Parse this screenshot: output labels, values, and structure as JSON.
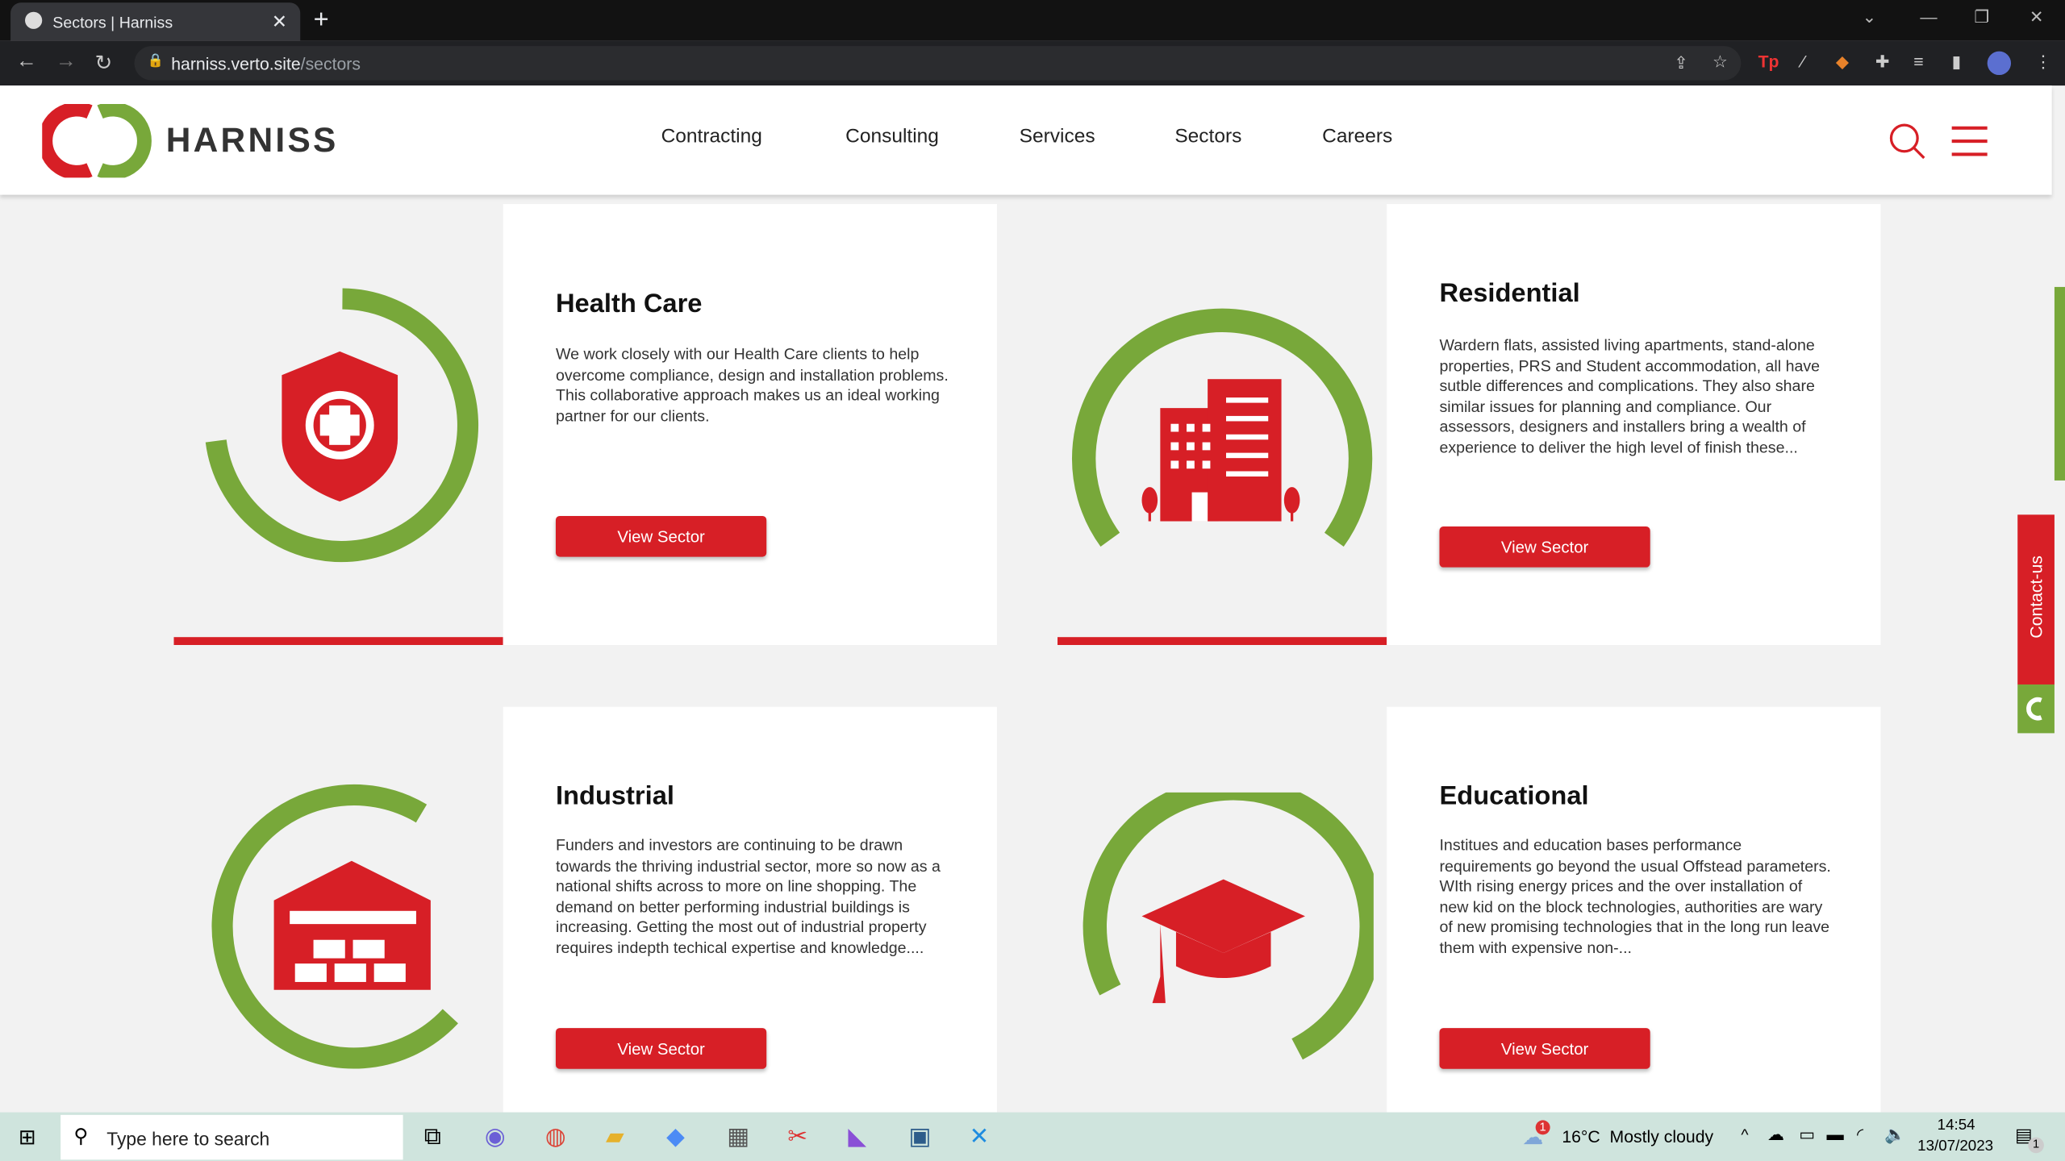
{
  "browser": {
    "tab_title": "Sectors | Harniss",
    "url_host": "harniss.verto.site",
    "url_path": "/sectors"
  },
  "header": {
    "logo_text": "HARNISS",
    "nav": [
      "Contracting",
      "Consulting",
      "Services",
      "Sectors",
      "Careers"
    ]
  },
  "sectors": [
    {
      "title": "Health Care",
      "description": "We work closely with our Health Care clients to help overcome compliance, design and installation problems. This collaborative approach makes us an ideal working partner for our clients.",
      "button": "View Sector",
      "icon": "shield-cross-icon"
    },
    {
      "title": "Residential",
      "description": "Wardern flats, assisted living apartments, stand-alone properties, PRS and Student accommodation, all have sutble differences and complications.  They also share similar issues for planning and compliance. Our assessors, designers and installers bring a wealth of experience to deliver the high level of finish these...",
      "button": "View Sector",
      "icon": "building-icon"
    },
    {
      "title": "Industrial",
      "description": "Funders and investors are continuing to be drawn towards the thriving industrial sector, more so now as a national shifts across to more on line shopping.  The demand on better performing industrial buildings is increasing. Getting the most out of industrial property requires indepth techical expertise and knowledge....",
      "button": "View Sector",
      "icon": "warehouse-icon"
    },
    {
      "title": "Educational",
      "description": "Institues and education bases performance requirements go beyond the usual Offstead parameters.  WIth rising energy prices and the over installation of new kid on the block technologies, authorities are wary of new promising technologies that in the long run leave them with expensive non-...",
      "button": "View Sector",
      "icon": "graduation-cap-icon"
    }
  ],
  "contact_tab": "Contact-us",
  "taskbar": {
    "search_placeholder": "Type here to search",
    "weather": "16°C  Mostly cloudy",
    "weather_badge": "1",
    "time": "14:54",
    "date": "13/07/2023",
    "notifications": "1"
  },
  "colors": {
    "brand_red": "#d71f26",
    "brand_green": "#78a83a"
  }
}
